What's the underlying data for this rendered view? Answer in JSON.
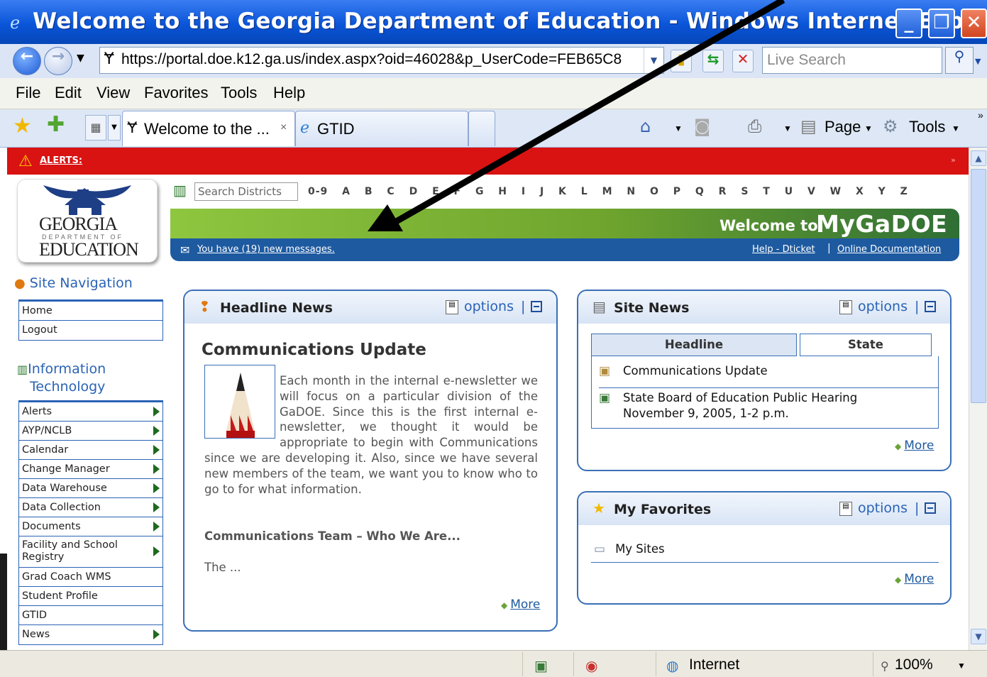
{
  "window": {
    "title": "Welcome to the Georgia Department of Education - Windows Internet Explorer",
    "min_label": "_",
    "max_label": "❐",
    "close_label": "✕"
  },
  "address_bar": {
    "url": "https://portal.doe.k12.ga.us/index.aspx?oid=46028&p_UserCode=FEB65C8",
    "search_placeholder": "Live Search"
  },
  "menu": [
    "File",
    "Edit",
    "View",
    "Favorites",
    "Tools",
    "Help"
  ],
  "tabs": [
    {
      "label": "Welcome to the ...",
      "close": "×"
    },
    {
      "label": "GTID"
    }
  ],
  "commands": {
    "page": "Page",
    "tools": "Tools"
  },
  "alerts": {
    "label": "ALERTS:"
  },
  "logo": {
    "line1": "GEORGIA",
    "line2": "DEPARTMENT OF",
    "line3": "EDUCATION"
  },
  "districts": {
    "placeholder": "Search Districts",
    "letters": "0-9 A B C D E F G H I J K L M N O P Q R S T U V W X Y Z"
  },
  "banner": {
    "welcome": "Welcome to",
    "brand": "MyGaDOE"
  },
  "messages": {
    "text": "You have (19) new messages."
  },
  "help_links": {
    "dticket": "Help - Dticket",
    "sep": "|",
    "docs": "Online Documentation"
  },
  "site_navigation": {
    "heading": "Site Navigation",
    "items": [
      {
        "label": "Home"
      },
      {
        "label": "Logout"
      }
    ]
  },
  "information_technology": {
    "heading_line1": "Information",
    "heading_line2": "Technology",
    "items": [
      {
        "label": "Alerts",
        "arrow": true
      },
      {
        "label": "AYP/NCLB",
        "arrow": true
      },
      {
        "label": "Calendar",
        "arrow": true
      },
      {
        "label": "Change Manager",
        "arrow": true
      },
      {
        "label": "Data Warehouse",
        "arrow": true
      },
      {
        "label": "Data Collection",
        "arrow": true
      },
      {
        "label": "Documents",
        "arrow": true
      },
      {
        "label": "Facility and School Registry",
        "arrow": true
      },
      {
        "label": "Grad Coach WMS",
        "arrow": false
      },
      {
        "label": "Student Profile",
        "arrow": false
      },
      {
        "label": "GTID",
        "arrow": false
      },
      {
        "label": "News",
        "arrow": true
      }
    ]
  },
  "headline_news": {
    "title": "Headline News",
    "options": "options",
    "sep": "|",
    "article_title": "Communications Update",
    "body": "Each month in the internal e-newsletter we will focus on a particular division of the GaDOE. Since this is the first internal e-newsletter, we thought it would be appropriate to begin with Communications since we are developing it. Also, since we have several new members of the team, we want you to know who to go to for what information.",
    "subheading": "Communications Team – Who We Are...",
    "teaser": "The ...",
    "more": "More"
  },
  "site_news": {
    "title": "Site News",
    "options": "options",
    "sep": "|",
    "tab_headline": "Headline",
    "tab_state": "State",
    "items": [
      {
        "line1": "Communications Update"
      },
      {
        "line1": "State Board of Education Public Hearing",
        "line2": "November 9, 2005, 1-2 p.m."
      }
    ],
    "more": "More"
  },
  "my_favorites": {
    "title": "My Favorites",
    "options": "options",
    "sep": "|",
    "item": "My Sites",
    "more": "More"
  },
  "status_bar": {
    "zone": "Internet",
    "zoom": "100%"
  }
}
